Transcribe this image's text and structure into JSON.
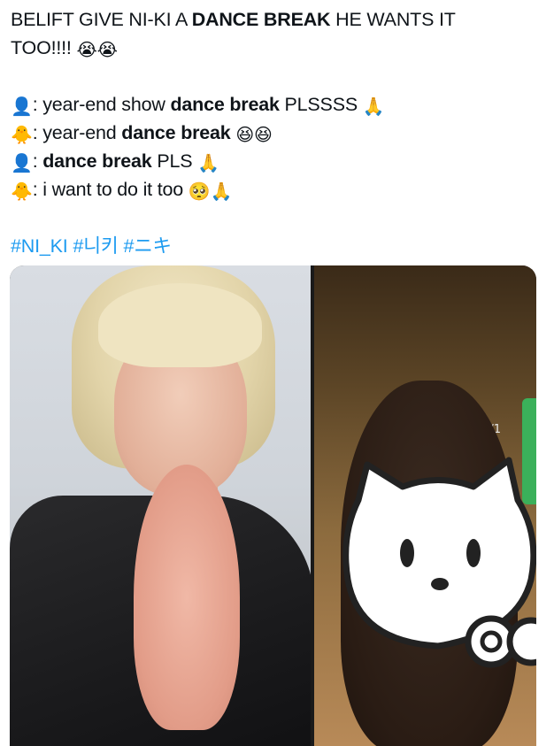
{
  "tweet": {
    "line1": {
      "a": "BELIFT GIVE NI-KI A ",
      "b": "DANCE BREAK",
      "c": " HE WANTS IT"
    },
    "line2": {
      "a": "TOO!!!! ",
      "emoji": "😭😭"
    },
    "dialogue": [
      {
        "speaker_emoji": "👤",
        "pre": ": year-end show ",
        "bold": "dance break",
        "post": " PLSSSS ",
        "end_emoji": "🙏"
      },
      {
        "speaker_emoji": "🐥",
        "pre": ": year-end ",
        "bold": "dance break",
        "post": " ",
        "end_emoji": "😆😆"
      },
      {
        "speaker_emoji": "👤",
        "pre": ": ",
        "bold": "dance break",
        "post": " PLS ",
        "end_emoji": "🙏"
      },
      {
        "speaker_emoji": "🐥",
        "pre": ": i want to do it too ",
        "bold": "",
        "post": "",
        "end_emoji": "🥺🙏"
      }
    ],
    "hashtags": [
      "#NI_KI",
      "#니키",
      "#ニキ"
    ]
  },
  "media": {
    "page_counter": "1/1"
  },
  "colors": {
    "text": "#0f1419",
    "hashtag": "#1d9bf0"
  }
}
